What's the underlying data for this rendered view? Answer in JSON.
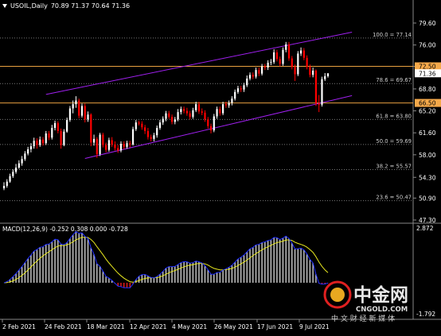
{
  "header": {
    "symbol": "USOIL,Daily",
    "ohlc": "70.89 71.37 70.64 71.36",
    "macd_label": "MACD(12,26,9) -0.252 0.308 0.000 -0.728"
  },
  "watermark": {
    "brand": "中金网",
    "domain": "CNGOLD.COM",
    "tagline": "中 文 财 经 新 媒 体"
  },
  "colors": {
    "background": "#000000",
    "candle_up": "#ffffff",
    "candle_down": "#ff0000",
    "channel": "#a020f0",
    "horizontal_level": "#e8a040",
    "fib_line": "#777777",
    "macd_signal": "#e8e820",
    "macd_line": "#2030ff",
    "macd_hist_up": "#dddddd",
    "macd_hist_down": "#ff2020",
    "price_box_bg": "#ffffff",
    "level_box_bg": "#f5a94a"
  },
  "chart_data": {
    "type": "candlestick",
    "instrument": "USOIL",
    "timeframe": "Daily",
    "last_bar": {
      "open": 70.89,
      "high": 71.37,
      "low": 70.64,
      "close": 71.36
    },
    "x_tick_labels": [
      "2 Feb 2021",
      "24 Feb 2021",
      "18 Mar 2021",
      "12 Apr 2021",
      "4 May 2021",
      "26 May 2021",
      "17 Jun 2021",
      "9 Jul 2021"
    ],
    "y_tick_labels": [
      "79.60",
      "76.00",
      "72.50",
      "68.80",
      "65.20",
      "61.60",
      "58.00",
      "54.30",
      "50.90",
      "47.30"
    ],
    "y_ticks": [
      79.6,
      76.0,
      72.5,
      68.8,
      65.2,
      61.6,
      58.0,
      54.3,
      50.9,
      47.3
    ],
    "ylim": [
      46.3,
      81.2
    ],
    "fibonacci_levels": [
      {
        "label": "100.0 = 77.14",
        "value": 77.14
      },
      {
        "label": "78.6 = 69.67",
        "value": 69.67
      },
      {
        "label": "61.8 = 63.80",
        "value": 63.8
      },
      {
        "label": "50.0 = 59.69",
        "value": 59.69
      },
      {
        "label": "38.2 = 55.57",
        "value": 55.57
      },
      {
        "label": "23.6 = 50.47",
        "value": 50.47
      }
    ],
    "horizontal_levels": [
      {
        "label": "72.50",
        "value": 72.5
      },
      {
        "label": "66.50",
        "value": 66.5
      }
    ],
    "current_price_label": "71.36",
    "candles": [
      [
        52.5,
        52.9,
        53.5,
        52.2
      ],
      [
        52.9,
        53.6,
        54.0,
        52.6
      ],
      [
        53.6,
        54.5,
        54.9,
        53.4
      ],
      [
        54.5,
        55.2,
        55.6,
        54.2
      ],
      [
        55.2,
        55.9,
        56.5,
        54.9
      ],
      [
        55.9,
        56.6,
        57.1,
        55.7
      ],
      [
        56.6,
        57.3,
        57.8,
        56.2
      ],
      [
        57.3,
        58.2,
        58.6,
        57.0
      ],
      [
        58.2,
        58.9,
        59.3,
        57.9
      ],
      [
        58.9,
        59.4,
        59.9,
        58.4
      ],
      [
        59.4,
        60.3,
        60.8,
        59.0
      ],
      [
        60.3,
        59.6,
        60.7,
        59.0
      ],
      [
        59.6,
        60.5,
        61.0,
        59.3
      ],
      [
        60.5,
        59.9,
        60.9,
        59.5
      ],
      [
        59.9,
        61.5,
        61.9,
        59.6
      ],
      [
        61.5,
        60.8,
        61.9,
        60.4
      ],
      [
        60.8,
        62.4,
        62.9,
        60.5
      ],
      [
        62.4,
        63.2,
        63.6,
        62.0
      ],
      [
        63.2,
        61.9,
        63.5,
        61.5
      ],
      [
        61.9,
        59.6,
        62.3,
        59.0
      ],
      [
        59.6,
        61.8,
        62.2,
        59.4
      ],
      [
        61.8,
        63.7,
        64.1,
        61.6
      ],
      [
        63.7,
        65.6,
        66.0,
        63.4
      ],
      [
        65.6,
        66.3,
        66.9,
        64.8
      ],
      [
        66.3,
        66.9,
        67.6,
        65.7
      ],
      [
        66.9,
        64.4,
        67.2,
        64.0
      ],
      [
        64.4,
        66.0,
        66.4,
        64.1
      ],
      [
        66.0,
        63.8,
        66.4,
        63.3
      ],
      [
        63.8,
        64.6,
        65.1,
        63.4
      ],
      [
        64.6,
        60.0,
        64.8,
        59.4
      ],
      [
        60.0,
        60.6,
        61.3,
        59.5
      ],
      [
        60.6,
        58.1,
        60.9,
        57.5
      ],
      [
        58.1,
        61.3,
        61.6,
        57.8
      ],
      [
        61.3,
        59.6,
        61.6,
        59.2
      ],
      [
        59.6,
        58.8,
        60.0,
        58.4
      ],
      [
        58.8,
        60.4,
        60.8,
        58.5
      ],
      [
        60.4,
        59.7,
        60.9,
        59.3
      ],
      [
        59.7,
        59.1,
        60.2,
        58.7
      ],
      [
        59.1,
        58.7,
        59.6,
        58.3
      ],
      [
        58.7,
        59.8,
        60.2,
        58.4
      ],
      [
        59.8,
        59.3,
        60.2,
        58.9
      ],
      [
        59.3,
        59.9,
        60.3,
        59.0
      ],
      [
        59.9,
        59.7,
        60.3,
        59.2
      ],
      [
        59.7,
        62.2,
        62.6,
        59.5
      ],
      [
        62.2,
        63.3,
        63.7,
        61.9
      ],
      [
        63.3,
        63.1,
        63.6,
        62.8
      ],
      [
        63.1,
        62.5,
        63.5,
        62.1
      ],
      [
        62.5,
        61.9,
        62.9,
        61.4
      ],
      [
        61.9,
        60.9,
        62.4,
        60.5
      ],
      [
        60.9,
        60.6,
        61.3,
        60.2
      ],
      [
        60.6,
        61.2,
        61.6,
        60.2
      ],
      [
        61.2,
        62.4,
        62.8,
        60.8
      ],
      [
        62.4,
        63.3,
        63.7,
        62.1
      ],
      [
        63.3,
        63.9,
        64.3,
        62.9
      ],
      [
        63.9,
        64.8,
        65.2,
        63.5
      ],
      [
        64.8,
        64.2,
        65.2,
        63.9
      ],
      [
        64.2,
        63.4,
        64.6,
        63.0
      ],
      [
        63.4,
        63.8,
        64.2,
        63.0
      ],
      [
        63.8,
        65.0,
        65.5,
        63.5
      ],
      [
        65.0,
        65.5,
        65.9,
        64.6
      ],
      [
        65.5,
        65.2,
        65.9,
        64.8
      ],
      [
        65.2,
        64.8,
        65.7,
        64.4
      ],
      [
        64.8,
        64.2,
        65.2,
        63.8
      ],
      [
        64.2,
        65.3,
        65.7,
        63.9
      ],
      [
        65.3,
        66.3,
        66.7,
        65.0
      ],
      [
        66.3,
        65.1,
        66.7,
        64.7
      ],
      [
        65.1,
        64.9,
        65.6,
        64.5
      ],
      [
        64.9,
        63.8,
        65.3,
        63.4
      ],
      [
        63.8,
        62.7,
        64.2,
        62.3
      ],
      [
        62.7,
        62.0,
        63.1,
        61.5
      ],
      [
        62.0,
        64.3,
        64.7,
        61.7
      ],
      [
        64.3,
        65.5,
        65.9,
        63.9
      ],
      [
        65.5,
        64.8,
        65.9,
        64.4
      ],
      [
        64.8,
        66.3,
        66.7,
        64.5
      ],
      [
        66.3,
        66.1,
        66.7,
        65.7
      ],
      [
        66.1,
        66.5,
        66.9,
        65.7
      ],
      [
        66.5,
        67.2,
        67.6,
        66.1
      ],
      [
        67.2,
        68.3,
        68.7,
        66.9
      ],
      [
        68.3,
        68.9,
        69.3,
        68.0
      ],
      [
        68.9,
        68.7,
        69.3,
        68.3
      ],
      [
        68.7,
        69.4,
        69.8,
        68.3
      ],
      [
        69.4,
        70.5,
        71.0,
        69.1
      ],
      [
        70.5,
        71.1,
        71.5,
        70.2
      ],
      [
        71.1,
        70.8,
        71.5,
        70.4
      ],
      [
        70.8,
        71.9,
        72.3,
        70.5
      ],
      [
        71.9,
        71.3,
        72.3,
        70.9
      ],
      [
        71.3,
        72.5,
        72.9,
        71.0
      ],
      [
        72.5,
        72.3,
        72.9,
        71.9
      ],
      [
        72.3,
        73.1,
        73.5,
        71.9
      ],
      [
        73.1,
        73.2,
        73.7,
        72.7
      ],
      [
        73.2,
        74.8,
        75.3,
        72.9
      ],
      [
        74.8,
        73.7,
        75.2,
        73.3
      ],
      [
        73.7,
        72.9,
        74.1,
        72.5
      ],
      [
        72.9,
        75.2,
        75.6,
        72.6
      ],
      [
        75.2,
        76.1,
        76.5,
        74.8
      ],
      [
        76.1,
        73.8,
        76.5,
        73.4
      ],
      [
        73.8,
        72.4,
        74.2,
        72.0
      ],
      [
        72.4,
        71.2,
        72.8,
        70.1
      ],
      [
        71.2,
        74.6,
        75.0,
        70.9
      ],
      [
        74.6,
        75.1,
        75.6,
        74.2
      ],
      [
        75.1,
        73.9,
        75.5,
        73.5
      ],
      [
        73.9,
        72.4,
        74.3,
        72.0
      ],
      [
        72.4,
        71.1,
        72.8,
        70.7
      ],
      [
        71.1,
        71.8,
        72.3,
        70.7
      ],
      [
        71.8,
        66.4,
        72.0,
        66.0
      ],
      [
        66.4,
        66.2,
        67.8,
        65.0
      ],
      [
        66.2,
        70.4,
        70.8,
        65.9
      ],
      [
        70.4,
        70.9,
        71.4,
        70.1
      ],
      [
        70.89,
        71.36,
        71.37,
        70.64
      ]
    ]
  },
  "macd_data": {
    "label": "MACD(12,26,9)",
    "values": {
      "main": -0.252,
      "signal": 0.308,
      "hist_a": 0.0,
      "hist_b": -0.728
    },
    "y_tick_labels": [
      "2.872",
      "-1.792"
    ],
    "ylim": [
      -1.792,
      2.872
    ]
  }
}
